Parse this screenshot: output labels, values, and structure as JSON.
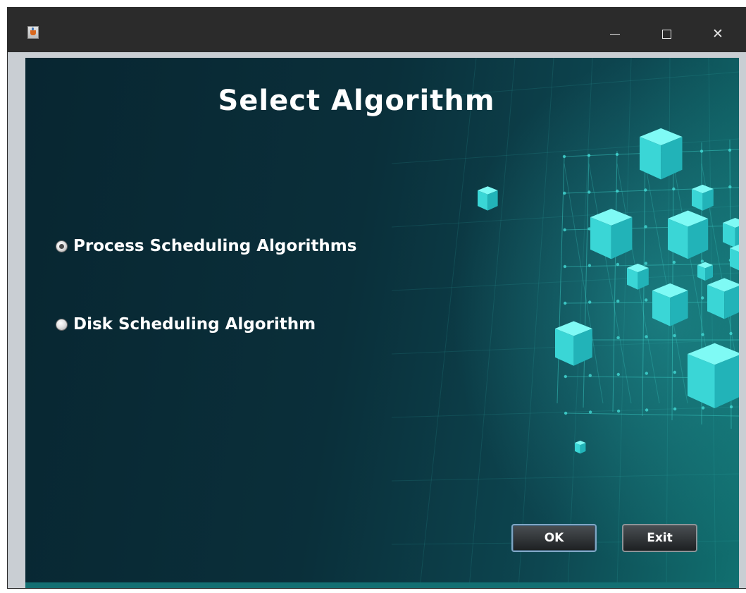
{
  "window": {
    "title": "",
    "minimize_label": "Minimize",
    "maximize_label": "Maximize",
    "close_label": "Close"
  },
  "main": {
    "heading": "Select Algorithm",
    "options": [
      {
        "label": "Process Scheduling Algorithms",
        "selected": true
      },
      {
        "label": "Disk Scheduling Algorithm",
        "selected": false
      }
    ],
    "ok_label": "OK",
    "exit_label": "Exit"
  },
  "colors": {
    "background_dark": "#082631",
    "accent_teal": "#3fe0e0",
    "titlebar": "#2b2b2b"
  },
  "icons": {
    "app": "java-cup-icon",
    "minimize": "minimize-icon",
    "maximize": "maximize-icon",
    "close": "close-icon"
  }
}
